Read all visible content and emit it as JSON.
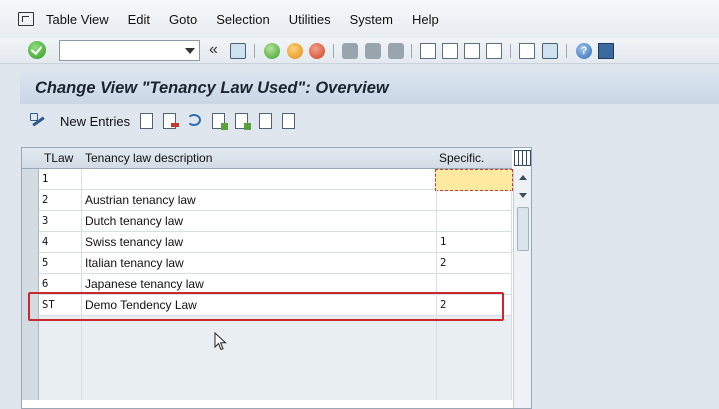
{
  "menu": {
    "items": [
      "Table View",
      "Edit",
      "Goto",
      "Selection",
      "Utilities",
      "System",
      "Help"
    ]
  },
  "toolbar": {
    "command_field_value": "",
    "back_glyph": "«"
  },
  "screen": {
    "title": "Change View \"Tenancy Law Used\": Overview"
  },
  "app_toolbar": {
    "new_entries_label": "New Entries"
  },
  "table": {
    "columns": [
      "TLaw",
      "Tenancy law description",
      "Specific."
    ],
    "rows": [
      {
        "key": "1",
        "description": "",
        "specific": ""
      },
      {
        "key": "2",
        "description": "Austrian tenancy law",
        "specific": ""
      },
      {
        "key": "3",
        "description": "Dutch tenancy law",
        "specific": ""
      },
      {
        "key": "4",
        "description": "Swiss tenancy law",
        "specific": "1"
      },
      {
        "key": "5",
        "description": "Italian tenancy law",
        "specific": "2"
      },
      {
        "key": "6",
        "description": "Japanese tenancy law",
        "specific": ""
      },
      {
        "key": "ST",
        "description": "Demo Tendency Law",
        "specific": "2"
      }
    ]
  },
  "colors": {
    "highlight_border": "#c8282e",
    "active_cell": "#fde9a0",
    "title_bar": "#dae5f0"
  }
}
